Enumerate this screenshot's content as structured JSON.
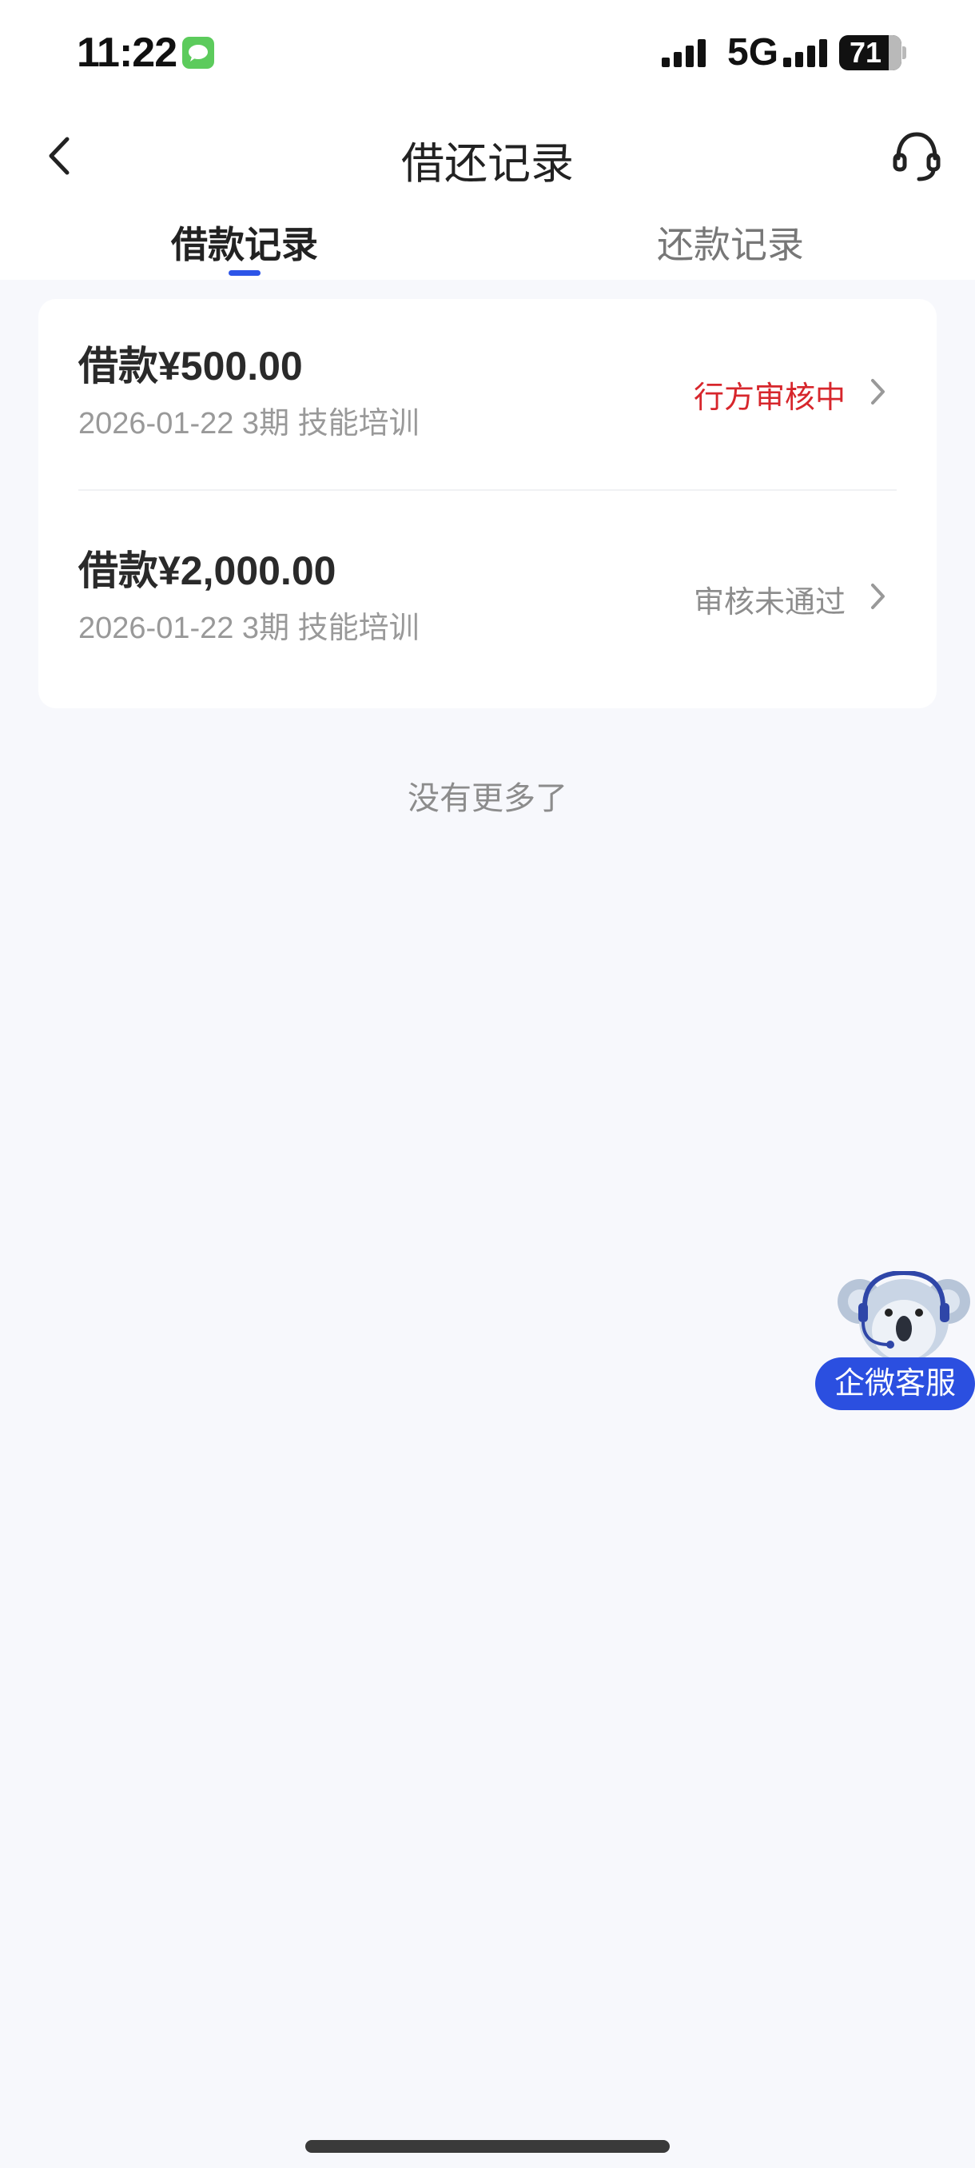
{
  "status_bar": {
    "time": "11:22",
    "network": "5G",
    "battery": "71"
  },
  "nav": {
    "title": "借还记录",
    "back_icon": "chevron-left-icon",
    "support_icon": "headset-icon"
  },
  "tabs": [
    {
      "label": "借款记录",
      "active": true
    },
    {
      "label": "还款记录",
      "active": false
    }
  ],
  "records": [
    {
      "amount": "借款¥500.00",
      "meta": "2026-01-22 3期  技能培训",
      "status": "行方审核中",
      "status_color": "#d7262c"
    },
    {
      "amount": "借款¥2,000.00",
      "meta": "2026-01-22 3期  技能培训",
      "status": "审核未通过",
      "status_color": "#8d8d8d"
    }
  ],
  "end_text": "没有更多了",
  "floating_service": {
    "label": "企微客服",
    "avatar_icon": "koala-headset-icon"
  },
  "colors": {
    "accent": "#2d55e8",
    "background": "#f7f8fc"
  }
}
